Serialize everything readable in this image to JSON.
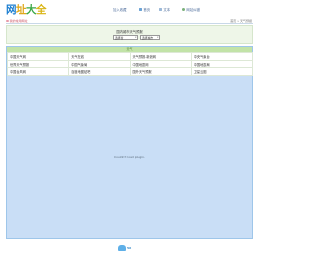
{
  "header": {
    "logo_chars": [
      "网",
      "址",
      "大",
      "全"
    ],
    "links": {
      "add_favorite": "加入收藏",
      "home": "首页",
      "text_version": "文本",
      "feedback": "网站纠错"
    }
  },
  "navbar": {
    "left": "我的常用网址",
    "right": "首页 » 天气预报"
  },
  "selector": {
    "title": "国内城市天气预报",
    "province": "选择省",
    "city": "选择城市"
  },
  "panel": {
    "category_header": "天气",
    "rows": [
      [
        "中国天气网",
        "天气在线",
        "天气预报-新浪网",
        "中央气象台"
      ],
      [
        "世界天气预报",
        "中国气象局",
        "中国地震网",
        "中国地震局"
      ],
      [
        "中国台风网",
        "百度地图贴吧",
        "国外天气预报",
        "卫星云图"
      ]
    ],
    "iframe_message": "Couldn't load plugin."
  },
  "footer": {
    "logo_text": "56"
  }
}
